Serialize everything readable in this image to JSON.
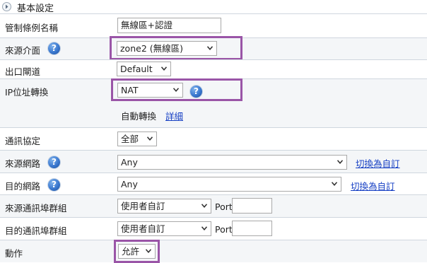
{
  "section": {
    "title": "基本設定"
  },
  "rows": {
    "policy_name": {
      "label": "管制條例名稱",
      "value": "無線區+認證"
    },
    "source_interface": {
      "label": "來源介面",
      "selected": "zone2 (無線區)"
    },
    "egress_gateway": {
      "label": "出口閘道",
      "selected": "Default"
    },
    "ip_translation": {
      "label": "IP位址轉換",
      "selected": "NAT",
      "auto_text": "自動轉換",
      "detail_link": "詳細"
    },
    "protocol": {
      "label": "通訊協定",
      "selected": "全部"
    },
    "source_network": {
      "label": "來源網路",
      "selected": "Any",
      "switch_link": "切換為自訂"
    },
    "dest_network": {
      "label": "目的網路",
      "selected": "Any",
      "switch_link": "切換為自訂"
    },
    "source_port_group": {
      "label": "來源通訊埠群組",
      "selected": "使用者自訂",
      "port_label": "Port",
      "port_value": ""
    },
    "dest_port_group": {
      "label": "目的通訊埠群組",
      "selected": "使用者自訂",
      "port_label": "Port",
      "port_value": ""
    },
    "action": {
      "label": "動作",
      "selected": "允許"
    }
  },
  "help_glyph": "?",
  "colors": {
    "highlight": "#9a55a7",
    "link": "#1740c4",
    "help": "#3a78cf"
  }
}
